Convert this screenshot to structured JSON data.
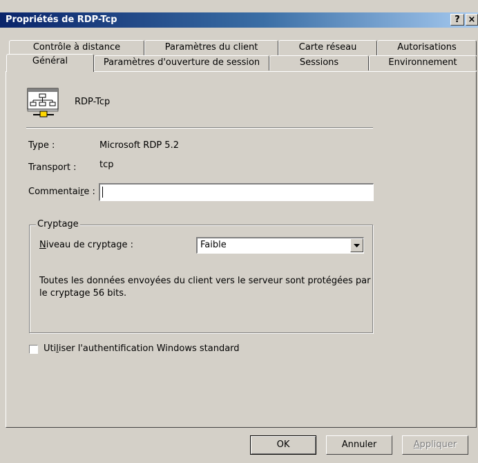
{
  "window": {
    "title": "Propriétés de RDP-Tcp",
    "help_label": "?",
    "close_label": "×"
  },
  "tabs": {
    "row1": [
      {
        "label": "Contrôle à distance"
      },
      {
        "label": "Paramètres du client"
      },
      {
        "label": "Carte réseau"
      },
      {
        "label": "Autorisations"
      }
    ],
    "row2": [
      {
        "label": "Général",
        "selected": true
      },
      {
        "label": "Paramètres d'ouverture de session"
      },
      {
        "label": "Sessions"
      },
      {
        "label": "Environnement"
      }
    ]
  },
  "general": {
    "connection_name": "RDP-Tcp",
    "type_label": "Type :",
    "type_value": "Microsoft RDP 5.2",
    "transport_label": "Transport :",
    "transport_value": "tcp",
    "comment_label_pre": "Commentai",
    "comment_label_accel": "r",
    "comment_label_post": "e :",
    "comment_value": ""
  },
  "encryption": {
    "group_title": "Cryptage",
    "level_label_accel": "N",
    "level_label_rest": "iveau de cryptage :",
    "level_value": "Faible",
    "description": "Toutes les données envoyées du client vers le serveur sont protégées par le cryptage 56 bits."
  },
  "auth": {
    "checkbox_label_pre": "Uti",
    "checkbox_label_accel": "l",
    "checkbox_label_post": "iser l'authentification Windows standard",
    "checked": false
  },
  "buttons": {
    "ok": "OK",
    "cancel": "Annuler",
    "apply_accel": "A",
    "apply_rest": "ppliquer"
  },
  "colors": {
    "title_start": "#0a246a",
    "title_end": "#a6caf0",
    "face": "#d4d0c8"
  }
}
